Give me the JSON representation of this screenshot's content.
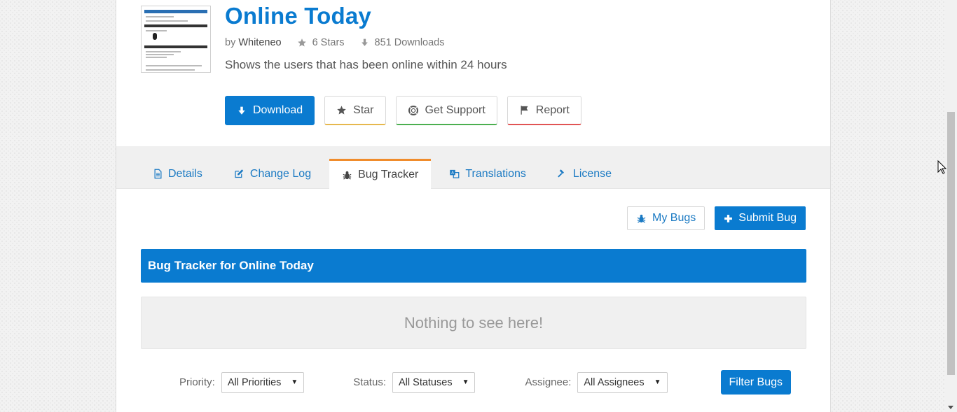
{
  "plugin": {
    "title": "Online Today",
    "by_label": "by",
    "author": "Whiteneo",
    "stars": "6 Stars",
    "downloads": "851 Downloads",
    "description": "Shows the users that has been online within 24 hours"
  },
  "actions": {
    "download": "Download",
    "star": "Star",
    "support": "Get Support",
    "report": "Report"
  },
  "tabs": [
    {
      "label": "Details",
      "icon": "document-icon"
    },
    {
      "label": "Change Log",
      "icon": "edit-icon"
    },
    {
      "label": "Bug Tracker",
      "icon": "bug-icon",
      "active": true
    },
    {
      "label": "Translations",
      "icon": "translate-icon"
    },
    {
      "label": "License",
      "icon": "gavel-icon"
    }
  ],
  "toolbar": {
    "my_bugs": "My Bugs",
    "submit_bug": "Submit Bug"
  },
  "panel": {
    "title": "Bug Tracker for Online Today",
    "empty_message": "Nothing to see here!"
  },
  "filters": {
    "priority_label": "Priority:",
    "priority_value": "All Priorities",
    "status_label": "Status:",
    "status_value": "All Statuses",
    "assignee_label": "Assignee:",
    "assignee_value": "All Assignees",
    "filter_button": "Filter Bugs"
  },
  "colors": {
    "brand_blue": "#0a7bd0",
    "active_tab_accent": "#f08c2c",
    "star_accent": "#e6b84e",
    "support_accent": "#4caf50",
    "report_accent": "#e15454"
  }
}
